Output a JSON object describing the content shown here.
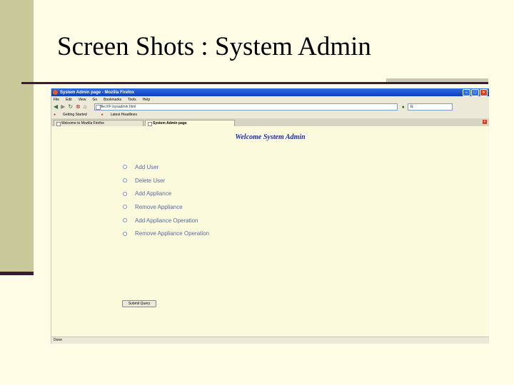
{
  "slide": {
    "title": "Screen Shots : System Admin"
  },
  "browser": {
    "window_title": "System Admin page - Mozilla Firefox",
    "menu": [
      "File",
      "Edit",
      "View",
      "Go",
      "Bookmarks",
      "Tools",
      "Help"
    ],
    "url": "file:///F:/sysadmin.html",
    "search_text": "G",
    "bookmarks": [
      "Getting Started",
      "Latest Headlines"
    ],
    "tabs": [
      {
        "label": "Welcome to Mozilla Firefox",
        "active": false
      },
      {
        "label": "System Admin page",
        "active": true
      }
    ],
    "status": "Done"
  },
  "page": {
    "heading": "Welcome System Admin",
    "options": [
      {
        "label": "Add User",
        "selected": false
      },
      {
        "label": "Delete User",
        "selected": false
      },
      {
        "label": "Add Appliance",
        "selected": false
      },
      {
        "label": "Remove Appliance",
        "selected": false
      },
      {
        "label": "Add Appliance Operation",
        "selected": false
      },
      {
        "label": "Remove Appliance Operation",
        "selected": false
      }
    ],
    "submit_label": "Submit Query"
  }
}
